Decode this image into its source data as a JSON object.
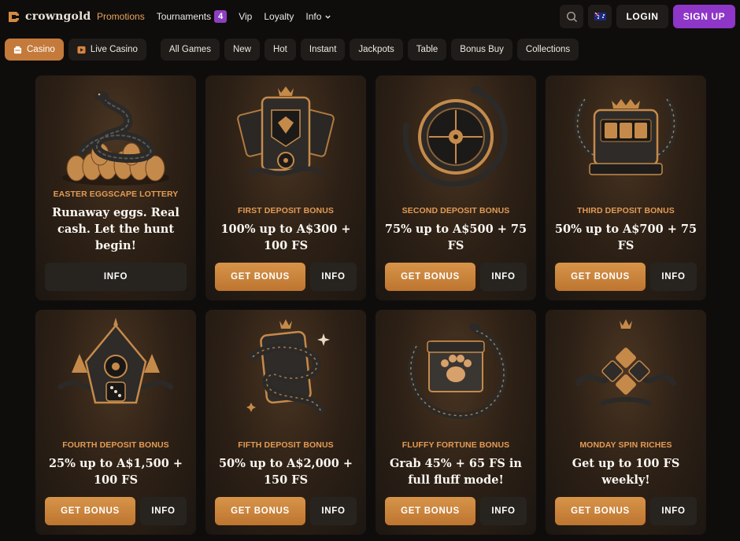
{
  "brand": {
    "name": "crowngold"
  },
  "nav": {
    "items": [
      {
        "label": "Promotions",
        "active": true
      },
      {
        "label": "Tournaments",
        "badge": "4"
      },
      {
        "label": "Vip"
      },
      {
        "label": "Loyalty"
      },
      {
        "label": "Info",
        "dropdown": true
      }
    ]
  },
  "header": {
    "search_icon": "search-icon",
    "region_flag": "australia-flag-icon",
    "login_label": "LOGIN",
    "signup_label": "SIGN UP"
  },
  "categories": {
    "primary": [
      {
        "label": "Casino",
        "icon": "casino-icon",
        "active": true
      },
      {
        "label": "Live Casino",
        "icon": "live-casino-icon"
      }
    ],
    "secondary": [
      {
        "label": "All Games"
      },
      {
        "label": "New"
      },
      {
        "label": "Hot"
      },
      {
        "label": "Instant"
      },
      {
        "label": "Jackpots"
      },
      {
        "label": "Table"
      },
      {
        "label": "Bonus Buy"
      },
      {
        "label": "Collections"
      }
    ]
  },
  "promos": [
    {
      "eyebrow": "EASTER EGGSCAPE LOTTERY",
      "headline": "Runaway eggs. Real cash. Let the hunt begin!",
      "get_label": "",
      "info_label": "INFO",
      "art": "snake-on-eggs-icon"
    },
    {
      "eyebrow": "FIRST DEPOSIT BONUS",
      "headline": "100% up to A$300 + 100 FS",
      "get_label": "GET BONUS",
      "info_label": "INFO",
      "art": "crowned-card-icon"
    },
    {
      "eyebrow": "SECOND DEPOSIT BONUS",
      "headline": "75% up to A$500 + 75 FS",
      "get_label": "GET BONUS",
      "info_label": "INFO",
      "art": "roulette-wheel-icon"
    },
    {
      "eyebrow": "THIRD DEPOSIT BONUS",
      "headline": "50% up to A$700 + 75 FS",
      "get_label": "GET BONUS",
      "info_label": "INFO",
      "art": "slot-machine-icon"
    },
    {
      "eyebrow": "FOURTH DEPOSIT BONUS",
      "headline": "25% up to A$1,500 + 100 FS",
      "get_label": "GET BONUS",
      "info_label": "INFO",
      "art": "dice-emblem-icon"
    },
    {
      "eyebrow": "FIFTH DEPOSIT BONUS",
      "headline": "50% up to A$2,000 + 150 FS",
      "get_label": "GET BONUS",
      "info_label": "INFO",
      "art": "snake-card-icon"
    },
    {
      "eyebrow": "FLUFFY FORTUNE BONUS",
      "headline": "Grab 45% + 65 FS in full fluff mode!",
      "get_label": "GET BONUS",
      "info_label": "INFO",
      "art": "paw-gift-box-icon"
    },
    {
      "eyebrow": "MONDAY SPIN RICHES",
      "headline": "Get up to 100 FS weekly!",
      "get_label": "GET BONUS",
      "info_label": "INFO",
      "art": "diamond-tiles-icon"
    }
  ],
  "colors": {
    "accent_orange": "#e39b55",
    "button_orange": "#c47a3a",
    "signup_purple": "#8e36c8",
    "badge_purple": "#8d3fc0",
    "background": "#0f0d0c"
  }
}
